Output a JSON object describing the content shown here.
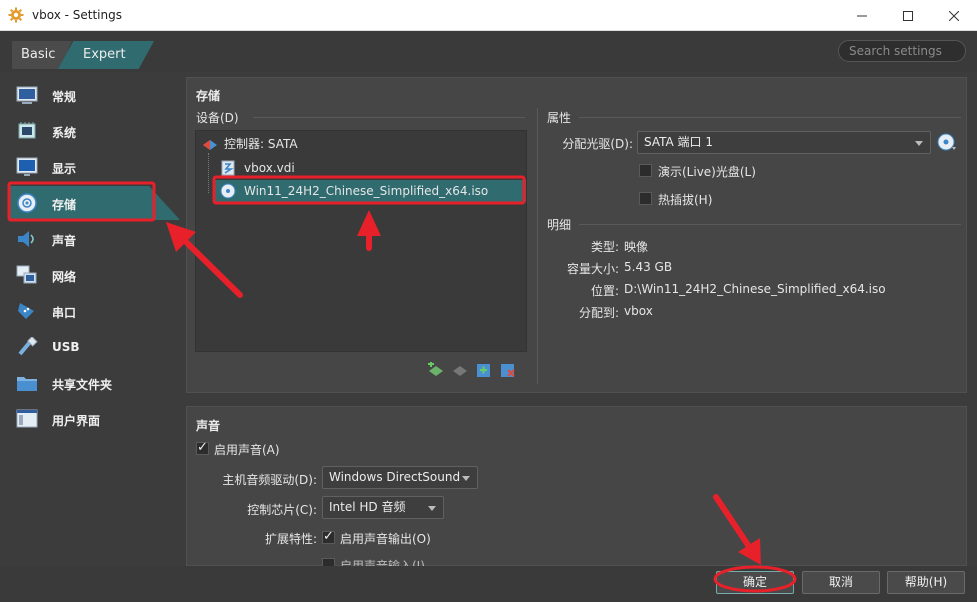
{
  "window": {
    "title": "vbox - Settings"
  },
  "mode": {
    "basic": "Basic",
    "expert": "Expert"
  },
  "search": {
    "placeholder": "Search settings"
  },
  "sidebar": {
    "items": [
      {
        "label": "常规",
        "icon": "general-icon"
      },
      {
        "label": "系统",
        "icon": "system-icon"
      },
      {
        "label": "显示",
        "icon": "display-icon"
      },
      {
        "label": "存储",
        "icon": "storage-icon"
      },
      {
        "label": "声音",
        "icon": "audio-icon"
      },
      {
        "label": "网络",
        "icon": "network-icon"
      },
      {
        "label": "串口",
        "icon": "serial-icon"
      },
      {
        "label": "USB",
        "icon": "usb-icon"
      },
      {
        "label": "共享文件夹",
        "icon": "shared-folder-icon"
      },
      {
        "label": "用户界面",
        "icon": "user-interface-icon"
      }
    ],
    "selected": "存储"
  },
  "storage": {
    "title": "存储",
    "devices_label": "设备(D)",
    "tree": {
      "controller": "控制器: SATA",
      "disk": "vbox.vdi",
      "iso": "Win11_24H2_Chinese_Simplified_x64.iso"
    },
    "attributes": {
      "title": "属性",
      "drive_label": "分配光驱(D):",
      "drive_value": "SATA 端口 1",
      "live_cd": "演示(Live)光盘(L)",
      "hotplug": "热插拔(H)"
    },
    "details": {
      "title": "明细",
      "rows": [
        {
          "key": "类型:",
          "value": "映像"
        },
        {
          "key": "容量大小:",
          "value": "5.43 GB"
        },
        {
          "key": "位置:",
          "value": "D:\\Win11_24H2_Chinese_Simplified_x64.iso"
        },
        {
          "key": "分配到:",
          "value": "vbox"
        }
      ]
    }
  },
  "audio": {
    "title": "声音",
    "enable": "启用声音(A)",
    "driver_label": "主机音频驱动(D):",
    "driver_value": "Windows DirectSound",
    "controller_label": "控制芯片(C):",
    "controller_value": "Intel HD 音频",
    "ext_label": "扩展特性:",
    "output": "启用声音输出(O)",
    "input": "启用声音输入(I)"
  },
  "buttons": {
    "ok": "确定",
    "cancel": "取消",
    "help": "帮助(H)"
  },
  "colors": {
    "accent": "#2f6b6f",
    "annotation": "#e8202a"
  }
}
